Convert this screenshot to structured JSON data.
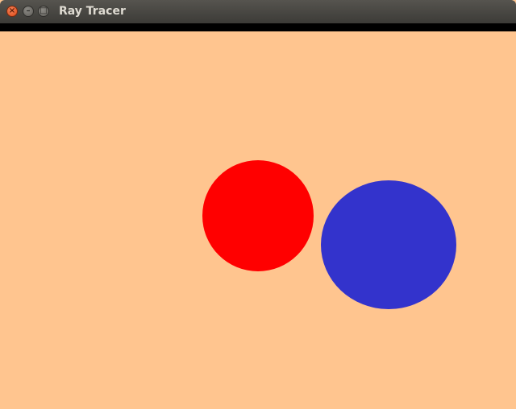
{
  "window": {
    "title": "Ray Tracer",
    "close_glyph": "×",
    "minimize_glyph": "–",
    "maximize_glyph": "□"
  },
  "scene": {
    "background_color": "#ffc58f",
    "objects": [
      {
        "name": "red-sphere",
        "color": "#ff0000"
      },
      {
        "name": "blue-sphere",
        "color": "#3333cc"
      }
    ]
  }
}
